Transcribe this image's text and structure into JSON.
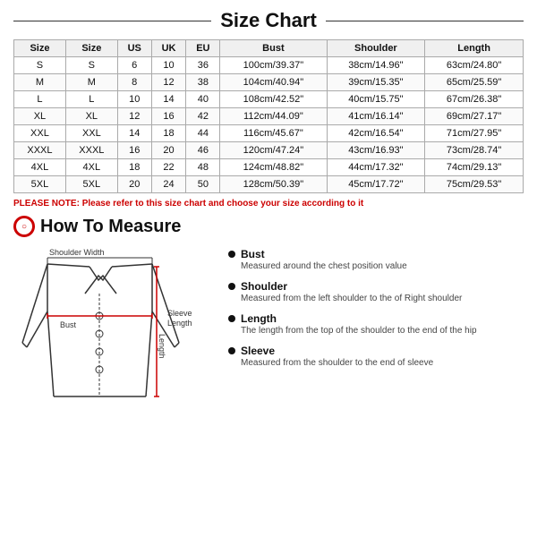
{
  "title": "Size Chart",
  "table": {
    "headers": [
      "Size",
      "Size",
      "US",
      "UK",
      "EU",
      "Bust",
      "Shoulder",
      "Length"
    ],
    "rows": [
      [
        "S",
        "S",
        "6",
        "10",
        "36",
        "100cm/39.37\"",
        "38cm/14.96\"",
        "63cm/24.80\""
      ],
      [
        "M",
        "M",
        "8",
        "12",
        "38",
        "104cm/40.94\"",
        "39cm/15.35\"",
        "65cm/25.59\""
      ],
      [
        "L",
        "L",
        "10",
        "14",
        "40",
        "108cm/42.52\"",
        "40cm/15.75\"",
        "67cm/26.38\""
      ],
      [
        "XL",
        "XL",
        "12",
        "16",
        "42",
        "112cm/44.09\"",
        "41cm/16.14\"",
        "69cm/27.17\""
      ],
      [
        "XXL",
        "XXL",
        "14",
        "18",
        "44",
        "116cm/45.67\"",
        "42cm/16.54\"",
        "71cm/27.95\""
      ],
      [
        "XXXL",
        "XXXL",
        "16",
        "20",
        "46",
        "120cm/47.24\"",
        "43cm/16.93\"",
        "73cm/28.74\""
      ],
      [
        "4XL",
        "4XL",
        "18",
        "22",
        "48",
        "124cm/48.82\"",
        "44cm/17.32\"",
        "74cm/29.13\""
      ],
      [
        "5XL",
        "5XL",
        "20",
        "24",
        "50",
        "128cm/50.39\"",
        "45cm/17.72\"",
        "75cm/29.53\""
      ]
    ]
  },
  "note_label": "PLEASE NOTE:",
  "note_text": " Please refer to this size chart and choose your size according to it",
  "how_to_measure_title": "How To Measure",
  "measurements": [
    {
      "label": "Bust",
      "desc": "Measured around the chest position value"
    },
    {
      "label": "Shoulder",
      "desc": "Measured from the left shoulder to the of Right shoulder"
    },
    {
      "label": "Length",
      "desc": "The length from the top of the shoulder to the end of the hip"
    },
    {
      "label": "Sleeve",
      "desc": "Measured from the shoulder to the end of sleeve"
    }
  ],
  "diagram_labels": {
    "shoulder_width": "Shoulder Width",
    "bust": "Bust",
    "sleeve_length": "Sleeve\nLength",
    "length": "Length"
  }
}
